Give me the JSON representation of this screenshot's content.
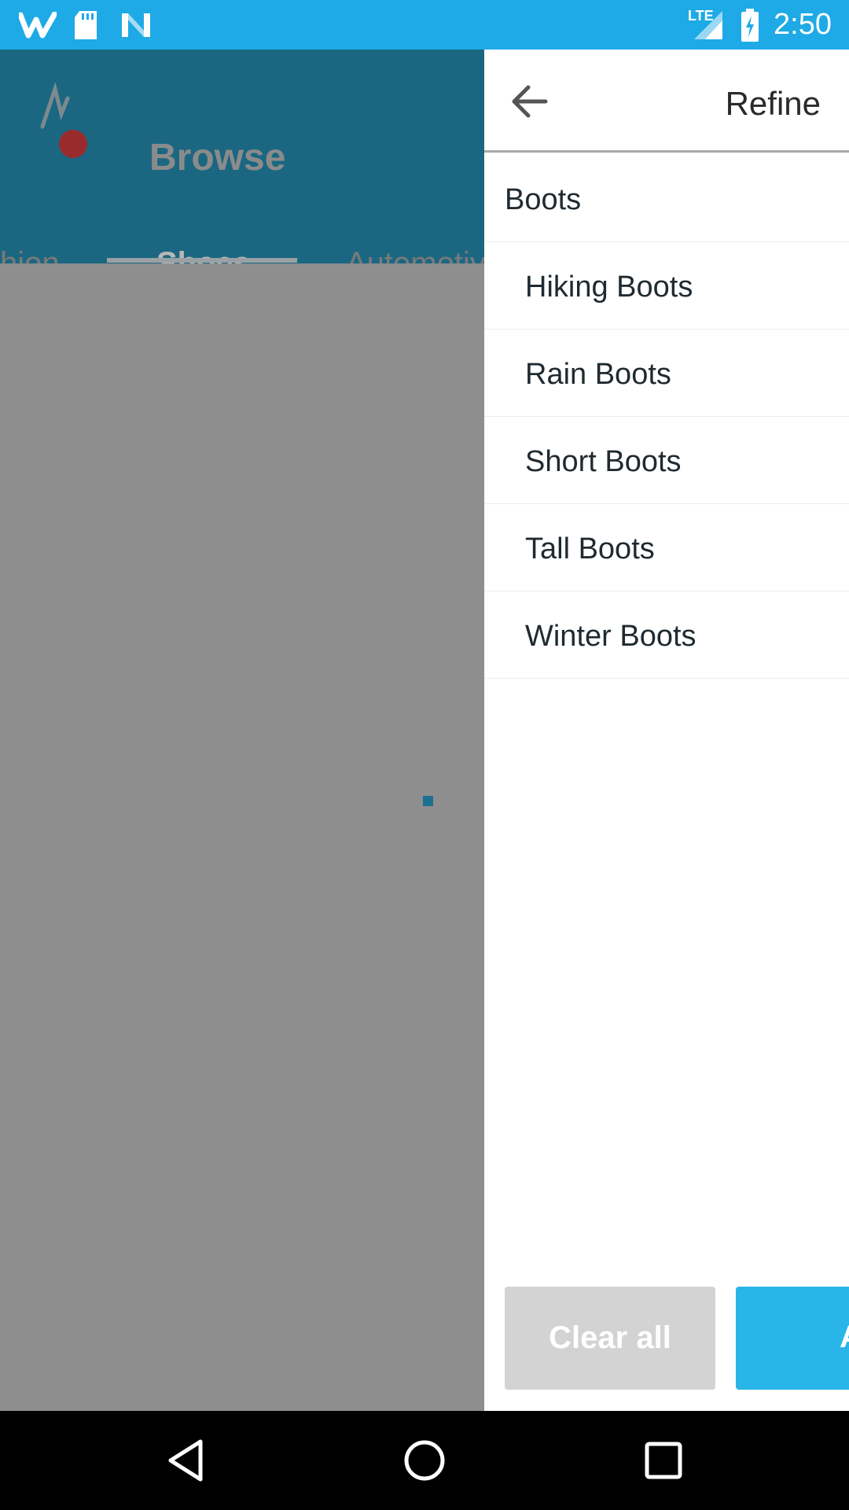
{
  "status_bar": {
    "time": "2:50",
    "network_label": "LTE",
    "icons": [
      "wish-app-icon",
      "sd-card-icon",
      "n-app-icon",
      "lte-signal-icon",
      "battery-charging-icon"
    ]
  },
  "app": {
    "title": "Browse",
    "tabs": [
      {
        "label": "Fashion",
        "visible_text": "hion"
      },
      {
        "label": "Shoes",
        "visible_text": "Shoes",
        "active": true
      },
      {
        "label": "Automotive",
        "visible_text": "Automotiv"
      }
    ]
  },
  "drawer": {
    "title": "Refine",
    "category": "Boots",
    "subcategories": [
      "Hiking Boots",
      "Rain Boots",
      "Short Boots",
      "Tall Boots",
      "Winter Boots"
    ],
    "clear_label": "Clear all",
    "apply_label": "A"
  },
  "colors": {
    "status_bar": "#1eaae6",
    "header": "#1b6782",
    "scrim": "#8e8e8e",
    "apply_button": "#29b5e8",
    "clear_button": "#d3d3d3"
  }
}
